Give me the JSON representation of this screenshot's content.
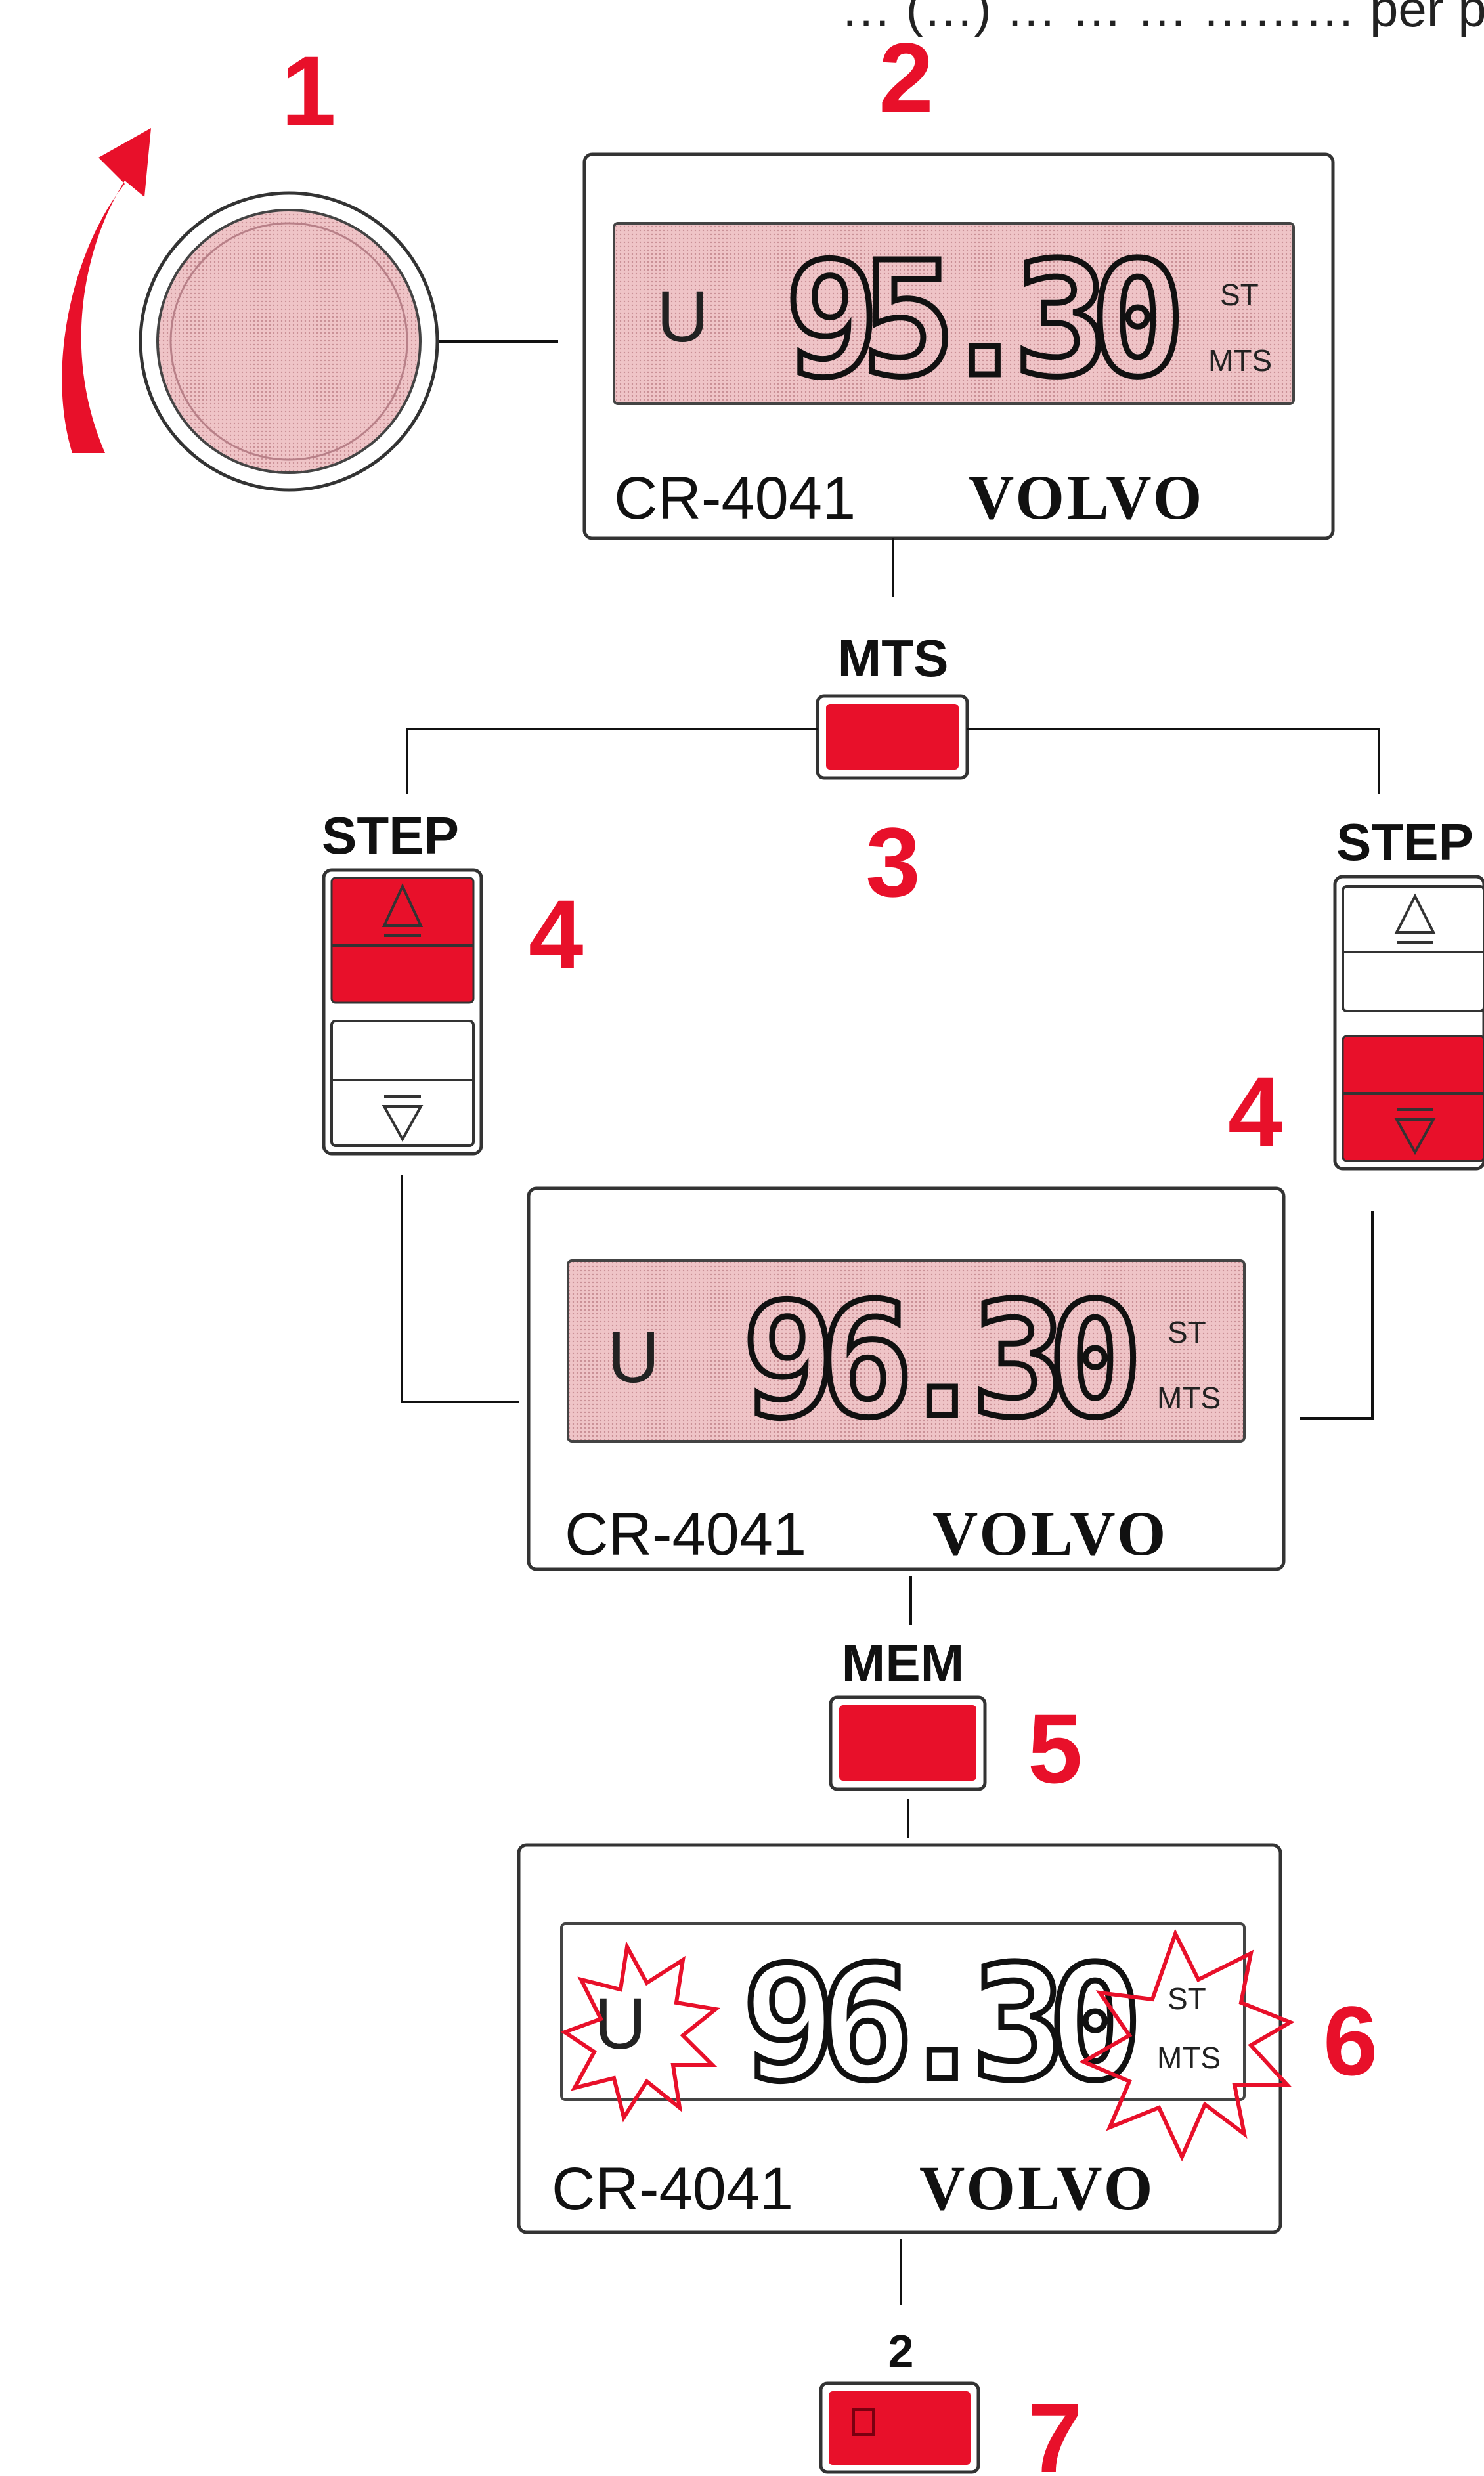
{
  "caption_fragment": "… (…) … … … ………  per programknapp)",
  "steps": {
    "s1": "1",
    "s2": "2",
    "s3": "3",
    "s4a": "4",
    "s4b": "4",
    "s5": "5",
    "s6": "6",
    "s7": "7"
  },
  "buttons": {
    "mts": "MTS",
    "step_left": "STEP",
    "step_right": "STEP",
    "mem": "MEM",
    "preset_number": "2"
  },
  "display_top": {
    "band": "U",
    "freq": "95.30",
    "st": "ST",
    "mts": "MTS",
    "model": "CR-4041",
    "brand": "VOLVO"
  },
  "display_mid": {
    "band": "U",
    "freq": "96.30",
    "st": "ST",
    "mts": "MTS",
    "model": "CR-4041",
    "brand": "VOLVO"
  },
  "display_bot": {
    "band": "U",
    "freq": "96.30",
    "st": "ST",
    "mts": "MTS",
    "model": "CR-4041",
    "brand": "VOLVO"
  },
  "colors": {
    "accent": "#e8102a",
    "lcd": "#e8b4b8",
    "knob": "#e9b7bb"
  }
}
